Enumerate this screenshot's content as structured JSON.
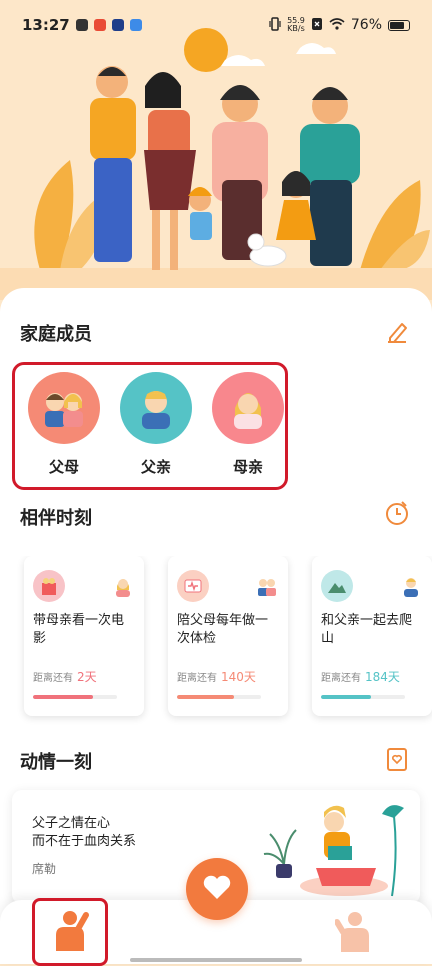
{
  "status_bar": {
    "time": "13:27",
    "net_speed_value": "55.9",
    "net_speed_unit": "KB/s",
    "battery": "76%"
  },
  "hero": {
    "icon": "family-illustration"
  },
  "family_members": {
    "title": "家庭成员",
    "edit_icon": "edit-icon",
    "items": [
      {
        "label": "父母",
        "color": "#f58a75"
      },
      {
        "label": "父亲",
        "color": "#55c3c6"
      },
      {
        "label": "母亲",
        "color": "#f8878d"
      }
    ]
  },
  "companion_moments": {
    "title": "相伴时刻",
    "icon": "timer-icon",
    "distance_label": "距离还有",
    "cards": [
      {
        "title_line1": "带母亲看一次电",
        "title_line2": "影",
        "days": "2天",
        "progress": 0.72,
        "color": "#f0727b"
      },
      {
        "title_line1": "陪父母每年做一",
        "title_line2": "次体检",
        "days": "140天",
        "progress": 0.68,
        "color": "#f58a75"
      },
      {
        "title_line1": "和父亲一起去爬",
        "title_line2": "山",
        "days": "184天",
        "progress": 0.6,
        "color": "#55c3c6"
      }
    ]
  },
  "moving_moment": {
    "title": "动情一刻",
    "icon": "notebook-heart-icon",
    "quote_line1": "父子之情在心",
    "quote_line2": "而不在于血肉关系",
    "author": "席勒"
  },
  "bottom_nav": {
    "me_icon": "person-waving-icon",
    "center_icon": "heart-plus-icon",
    "other_icon": "person-icon"
  }
}
